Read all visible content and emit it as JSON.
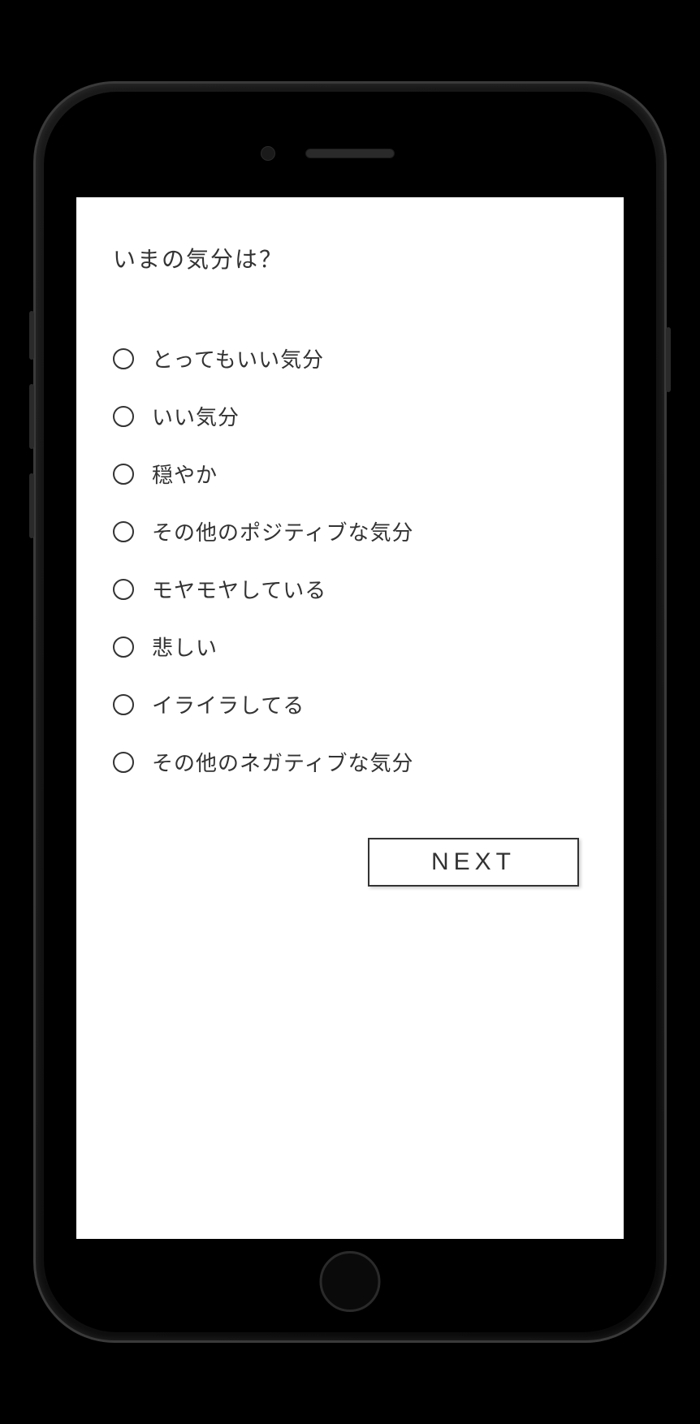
{
  "question": {
    "title": "いまの気分は？"
  },
  "options": [
    {
      "label": "とってもいい気分"
    },
    {
      "label": "いい気分"
    },
    {
      "label": "穏やか"
    },
    {
      "label": "その他のポジティブな気分"
    },
    {
      "label": "モヤモヤしている"
    },
    {
      "label": "悲しい"
    },
    {
      "label": "イライラしてる"
    },
    {
      "label": "その他のネガティブな気分"
    }
  ],
  "buttons": {
    "next": "NEXT"
  }
}
